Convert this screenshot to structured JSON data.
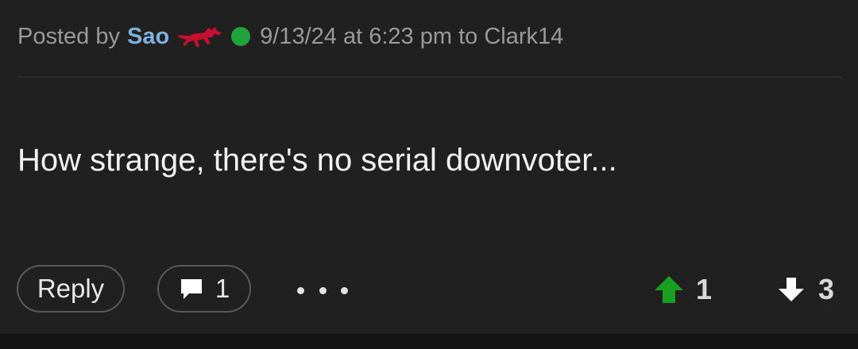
{
  "post": {
    "posted_by_prefix": "Posted by",
    "author": "Sao",
    "timestamp": "9/13/24 at 6:23 pm to Clark14",
    "body": "How strange, there's no serial downvoter...",
    "team_logo_icon": "mustang-logo",
    "online_status_color": "#1fa33a"
  },
  "actions": {
    "reply_label": "Reply",
    "comment_count": "1",
    "more_icon": "ellipsis-icon",
    "upvote_count": "1",
    "downvote_count": "3",
    "upvote_color": "#19a021",
    "downvote_color": "#ffffff"
  }
}
